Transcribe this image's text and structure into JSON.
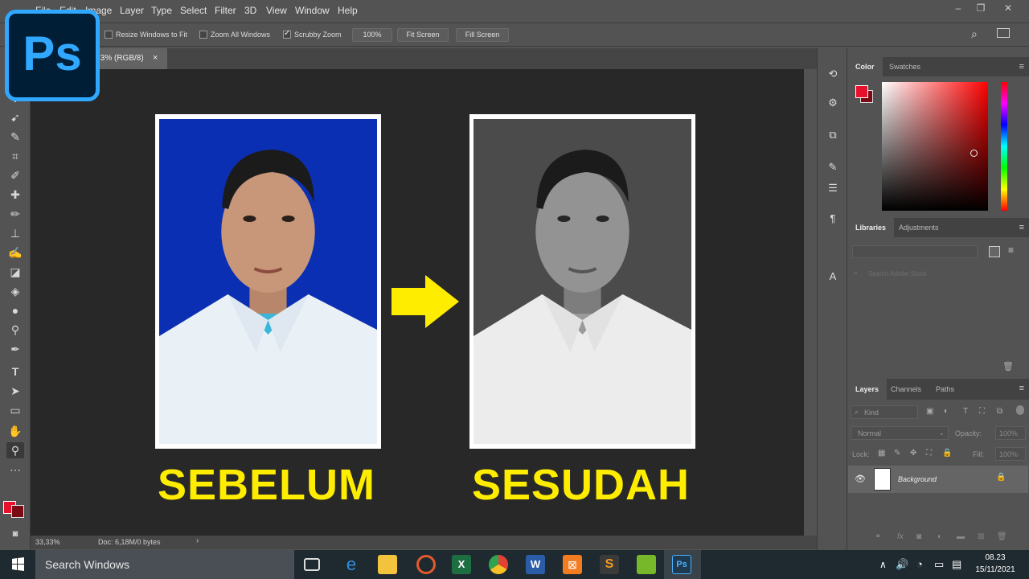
{
  "menu": {
    "items": [
      "File",
      "Edit",
      "Image",
      "Layer",
      "Type",
      "Select",
      "Filter",
      "3D",
      "View",
      "Window",
      "Help"
    ]
  },
  "options": {
    "resize_windows": "Resize Windows to Fit",
    "zoom_all": "Zoom All Windows",
    "scrubby_zoom": "Scrubby Zoom",
    "zoom_value": "100%",
    "fit_screen": "Fit Screen",
    "fill_screen": "Fill Screen"
  },
  "doc_tab": {
    "label": ",3% (RGB/8)",
    "close": "×"
  },
  "canvas": {
    "caption_before": "SEBELUM",
    "caption_after": "SESUDAH"
  },
  "status": {
    "zoom": "33,33%",
    "doc": "Doc: 6,18M/0 bytes"
  },
  "panels": {
    "color_tabs": [
      "Color",
      "Swatches"
    ],
    "library_tabs": [
      "Libraries",
      "Adjustments"
    ],
    "library_search_placeholder": "Search Adobe Stock",
    "layer_tabs": [
      "Layers",
      "Channels",
      "Paths"
    ],
    "kind_filter": "Kind",
    "blend_mode": "Normal",
    "opacity_label": "Opacity:",
    "opacity_value": "100%",
    "lock_label": "Lock:",
    "fill_label": "Fill:",
    "fill_value": "100%",
    "layer_name": "Background"
  },
  "logo": {
    "text": "Ps"
  },
  "taskbar": {
    "search_placeholder": "Search Windows",
    "time": "08.23",
    "date": "15/11/2021"
  },
  "colors": {
    "foreground": "#e8112d",
    "background": "#7a0a14",
    "caption": "#ffed00",
    "ps_blue": "#31a8ff"
  }
}
